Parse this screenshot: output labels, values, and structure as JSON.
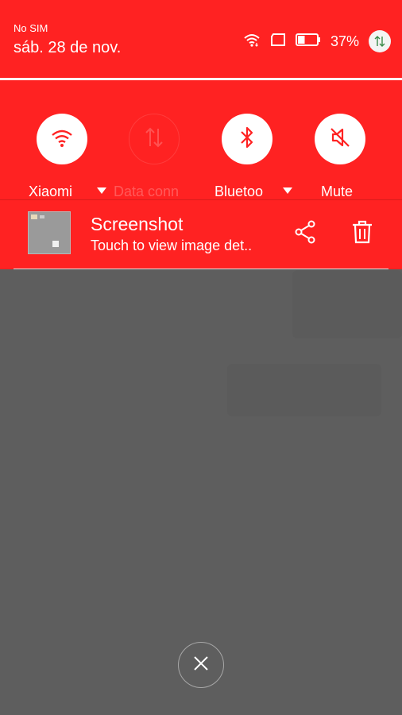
{
  "status_bar": {
    "carrier": "No SIM",
    "date": "sáb. 28 de nov.",
    "battery_percent": "37%",
    "icons": [
      "wifi-icon",
      "sim-card-icon",
      "battery-icon",
      "data-toggle-icon"
    ],
    "battery_level": 0.37
  },
  "quick_settings": {
    "tiles": [
      {
        "label": "Xiaomi",
        "icon": "wifi-icon",
        "state": "on",
        "has_dropdown": true
      },
      {
        "label": "Data conn",
        "icon": "data-arrows-icon",
        "state": "off",
        "has_dropdown": false
      },
      {
        "label": "Bluetoo",
        "icon": "bluetooth-icon",
        "state": "on",
        "has_dropdown": true
      },
      {
        "label": "Mute",
        "icon": "mute-icon",
        "state": "on",
        "has_dropdown": false
      }
    ]
  },
  "notification": {
    "title": "Screenshot",
    "text": "Touch to view image det..",
    "actions": [
      "share-icon",
      "delete-icon"
    ]
  },
  "controls": {
    "close_icon": "close-icon"
  },
  "colors": {
    "accent": "#ff2222",
    "backdrop": "#5e5e5e",
    "white": "#ffffff"
  }
}
